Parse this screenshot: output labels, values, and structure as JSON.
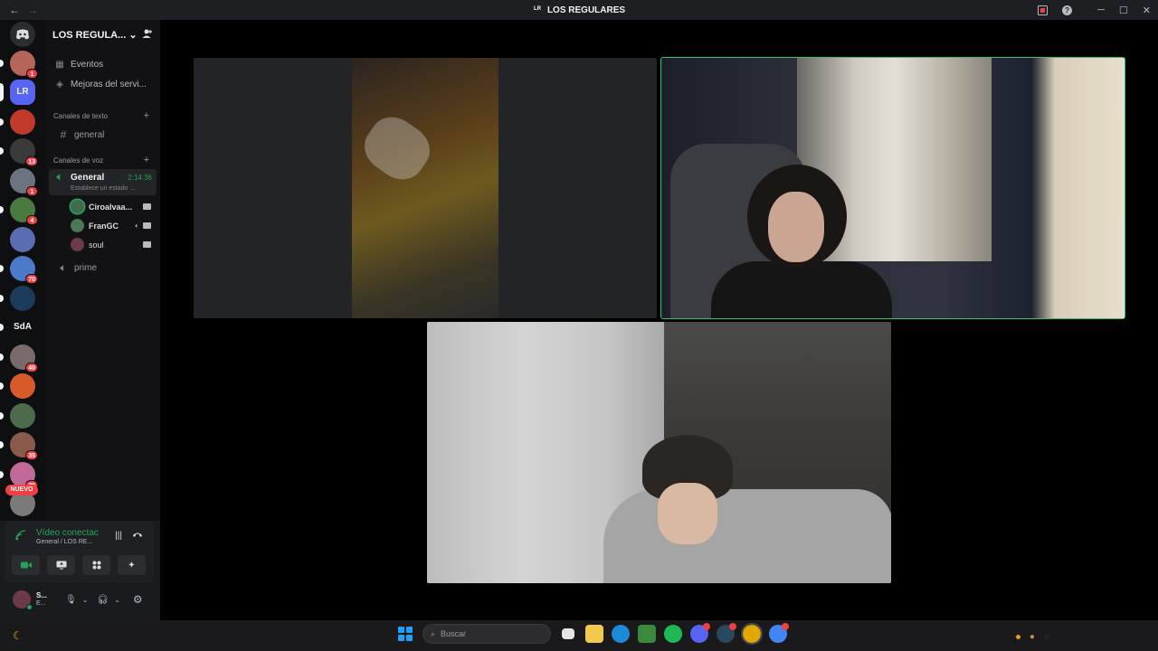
{
  "window": {
    "title": "LOS REGULARES",
    "server_abbr": "LR",
    "back_arrow": "←",
    "forward_arrow": "→",
    "controls": [
      "─",
      "☐",
      "✕"
    ]
  },
  "guilds": {
    "items": [
      {
        "name": "discord-home",
        "color": "#2b2d31"
      },
      {
        "name": "server-1",
        "color": "#b5655a",
        "badge": "1",
        "unread": true
      },
      {
        "name": "server-lr",
        "color": "#5865f2",
        "label": "LR",
        "active": true
      },
      {
        "name": "server-3",
        "color": "#c0392b",
        "unread": true
      },
      {
        "name": "server-4",
        "color": "#3a3a3a",
        "badge": "13",
        "unread": true
      },
      {
        "name": "server-5",
        "color": "#6b7280",
        "badge": "1"
      },
      {
        "name": "server-6",
        "color": "#4a7a40",
        "badge": "4",
        "unread": true
      },
      {
        "name": "server-7",
        "color": "#5a6db0"
      },
      {
        "name": "server-8",
        "color": "#4a7ac8",
        "badge": "70",
        "unread": true
      },
      {
        "name": "server-9",
        "color": "#1d3b5a",
        "unread": true
      },
      {
        "name": "server-sda",
        "color": "transparent",
        "label": "SdA",
        "unread": true
      },
      {
        "name": "server-11",
        "color": "#7a6a6a",
        "badge": "40",
        "unread": true
      },
      {
        "name": "server-12",
        "color": "#d85a2a",
        "unread": true
      },
      {
        "name": "server-13",
        "color": "#4b6b4b",
        "unread": true
      },
      {
        "name": "server-14",
        "color": "#8a5a4a",
        "badge": "35",
        "unread": true
      },
      {
        "name": "server-15",
        "color": "#c06a9a",
        "badge": "26",
        "unread": true
      },
      {
        "name": "server-16",
        "color": "#7a7a7a"
      }
    ],
    "new_label": "NUEVO"
  },
  "sidebar": {
    "server_name": "LOS REGULA...",
    "menu": [
      {
        "label": "Eventos",
        "icon": "calendar-icon"
      },
      {
        "label": "Mejoras del servi...",
        "icon": "boost-icon"
      }
    ],
    "text_category": "Canales de texto",
    "text_channels": [
      {
        "label": "general"
      }
    ],
    "voice_category": "Canales de voz",
    "active_voice": {
      "label": "General",
      "timer": "2:14:36",
      "status": "Establece un estado ..."
    },
    "voice_users": [
      {
        "name": "Ciroalvaa...",
        "color": "#3f6b4b",
        "speaking": true,
        "camera": true
      },
      {
        "name": "FranGC",
        "color": "#4a7a55",
        "speaking": false,
        "camera": true,
        "muted": true
      },
      {
        "name": "soul",
        "color": "#6d3a4a",
        "speaking": false,
        "camera": true
      }
    ],
    "other_voice": [
      {
        "label": "prime"
      }
    ]
  },
  "rtc_panel": {
    "connection": "Vídeo conectac",
    "location": "General / LOS RE..."
  },
  "user_panel": {
    "name": "S...",
    "status": "E..."
  },
  "taskbar": {
    "search_placeholder": "Buscar",
    "apps": [
      {
        "name": "file-explorer",
        "color": "#f2c94c"
      },
      {
        "name": "edge",
        "color": "#1c8ad6"
      },
      {
        "name": "minecraft",
        "color": "#3b8a3b"
      },
      {
        "name": "spotify",
        "color": "#1db954"
      },
      {
        "name": "discord",
        "color": "#5865f2"
      },
      {
        "name": "steam",
        "color": "#2a475e"
      },
      {
        "name": "chrome",
        "color": "#e0a800"
      },
      {
        "name": "chrome-profile",
        "color": "#4285f4"
      }
    ]
  }
}
